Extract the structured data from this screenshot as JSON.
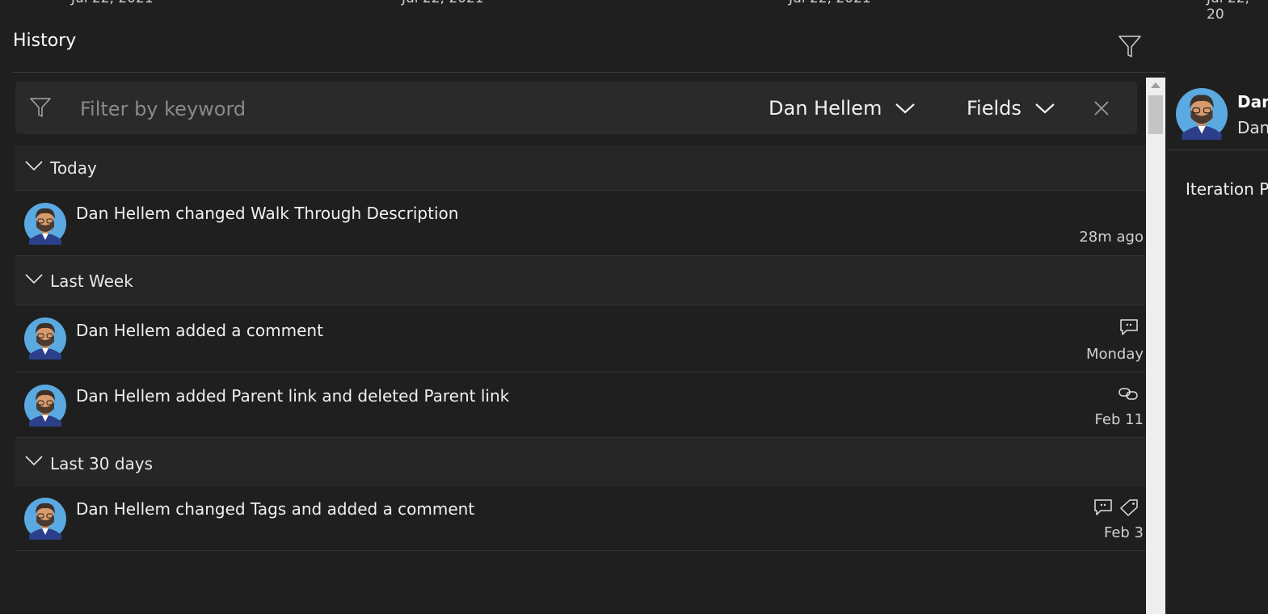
{
  "top_dates": [
    "Jul 22, 2021",
    "Jul 22, 2021",
    "Jul 22, 2021",
    "Jul 22, 20"
  ],
  "header": {
    "title": "History"
  },
  "filter_bar": {
    "placeholder": "Filter by keyword",
    "user_dropdown": "Dan Hellem",
    "fields_dropdown": "Fields"
  },
  "groups": [
    {
      "label": "Today",
      "items": [
        {
          "text": "Dan Hellem changed Walk Through Description",
          "time": "28m ago",
          "icons": []
        }
      ]
    },
    {
      "label": "Last Week",
      "items": [
        {
          "text": "Dan Hellem added a comment",
          "time": "Monday",
          "icons": [
            "comment-icon"
          ]
        },
        {
          "text": "Dan Hellem added Parent link and deleted Parent link",
          "time": "Feb 11",
          "icons": [
            "link-icon"
          ]
        }
      ]
    },
    {
      "label": "Last 30 days",
      "items": [
        {
          "text": "Dan Hellem changed Tags and added a comment",
          "time": "Feb 3",
          "icons": [
            "comment-icon",
            "tag-icon"
          ]
        }
      ]
    }
  ],
  "side_panel": {
    "name_bold": "Dan",
    "name_sub": "Dan",
    "field_label": "Iteration P"
  },
  "colors": {
    "background": "#1f1f1f",
    "group_header": "#262626",
    "filter_bar": "#2a2a2a",
    "scrollbar": "#eeeeee"
  }
}
